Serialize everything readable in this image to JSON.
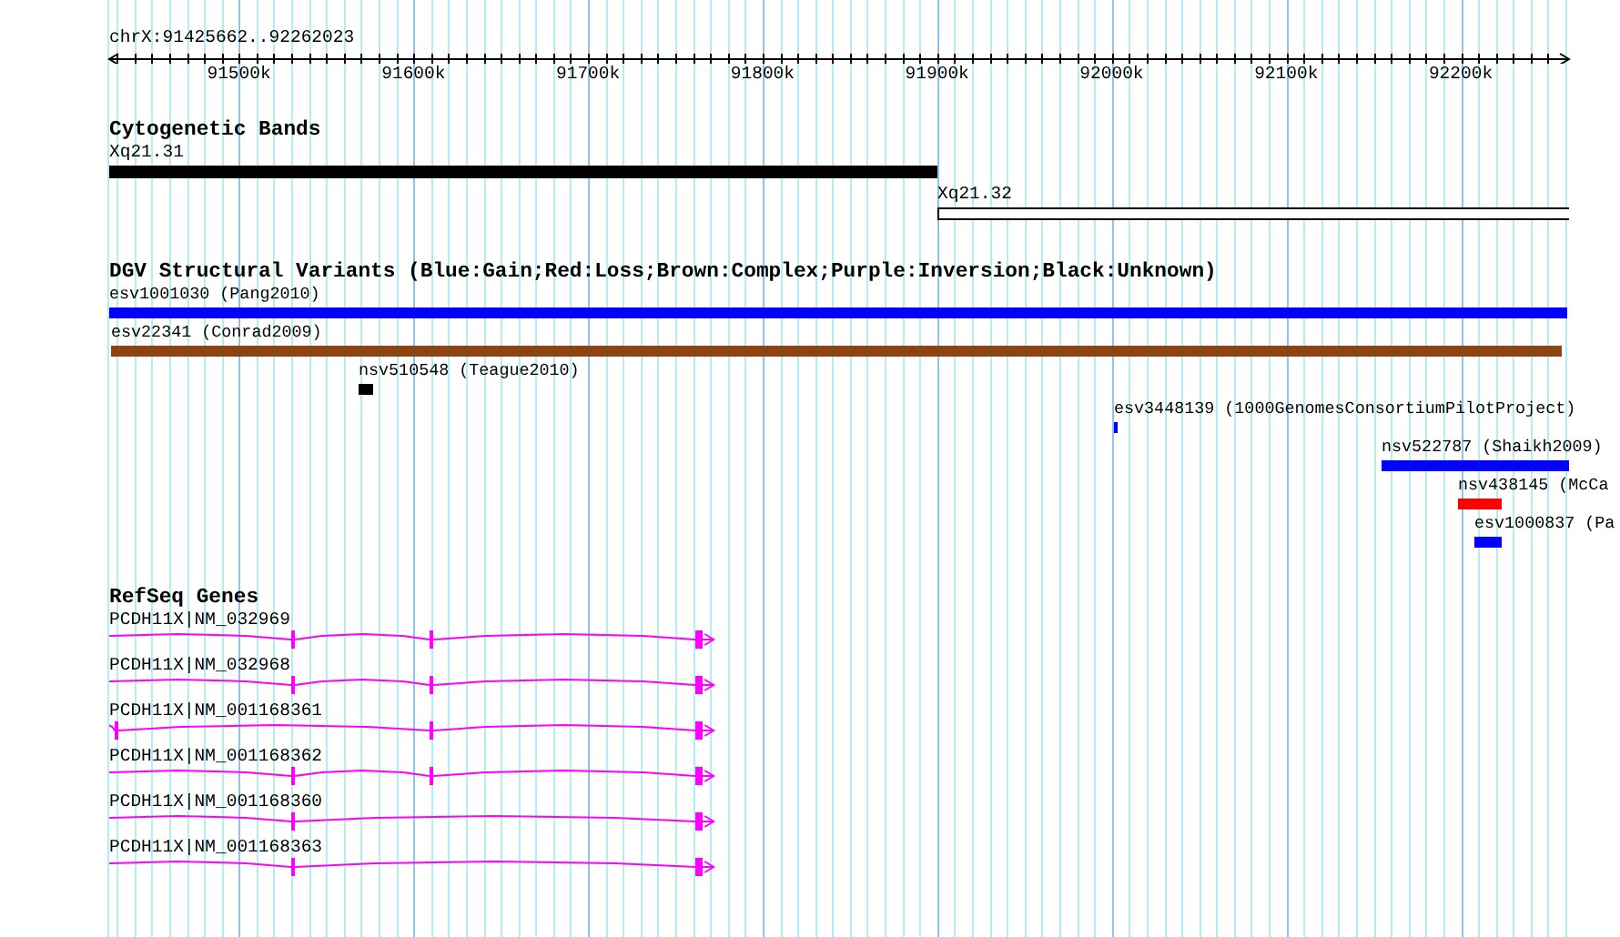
{
  "ruler": {
    "title": "chrX:91425662..92262023",
    "labels": [
      "91500k",
      "91600k",
      "91700k",
      "91800k",
      "91900k",
      "92000k",
      "92100k",
      "92200k"
    ]
  },
  "tracks": [
    {
      "kind": "bands",
      "title": "Cytogenetic Bands",
      "features": [
        {
          "label": "Xq21.31",
          "color": "#000000"
        },
        {
          "label": "Xq21.32",
          "color": "#ffffff"
        }
      ]
    },
    {
      "kind": "variants",
      "title": "DGV Structural Variants (Blue:Gain;Red:Loss;Brown:Complex;Purple:Inversion;Black:Unknown)",
      "features": [
        {
          "label": "esv1001030 (Pang2010)",
          "color": "#0000ff"
        },
        {
          "label": "esv22341 (Conrad2009)",
          "color": "#8b4513"
        },
        {
          "label": "nsv510548 (Teague2010)",
          "color": "#000000"
        },
        {
          "label": "esv3448139 (1000GenomesConsortiumPilotProject)",
          "color": "#0000ff"
        },
        {
          "label": "nsv522787 (Shaikh2009)",
          "color": "#0000ff"
        },
        {
          "label": "nsv438145 (McCa",
          "color": "#ff0000"
        },
        {
          "label": "esv1000837 (Pa",
          "color": "#0000ff"
        }
      ]
    },
    {
      "kind": "genes",
      "title": "RefSeq Genes",
      "features": [
        {
          "label": "PCDH11X|NM_032969"
        },
        {
          "label": "PCDH11X|NM_032968"
        },
        {
          "label": "PCDH11X|NM_001168361"
        },
        {
          "label": "PCDH11X|NM_001168362"
        },
        {
          "label": "PCDH11X|NM_001168360"
        },
        {
          "label": "PCDH11X|NM_001168363"
        }
      ]
    }
  ]
}
